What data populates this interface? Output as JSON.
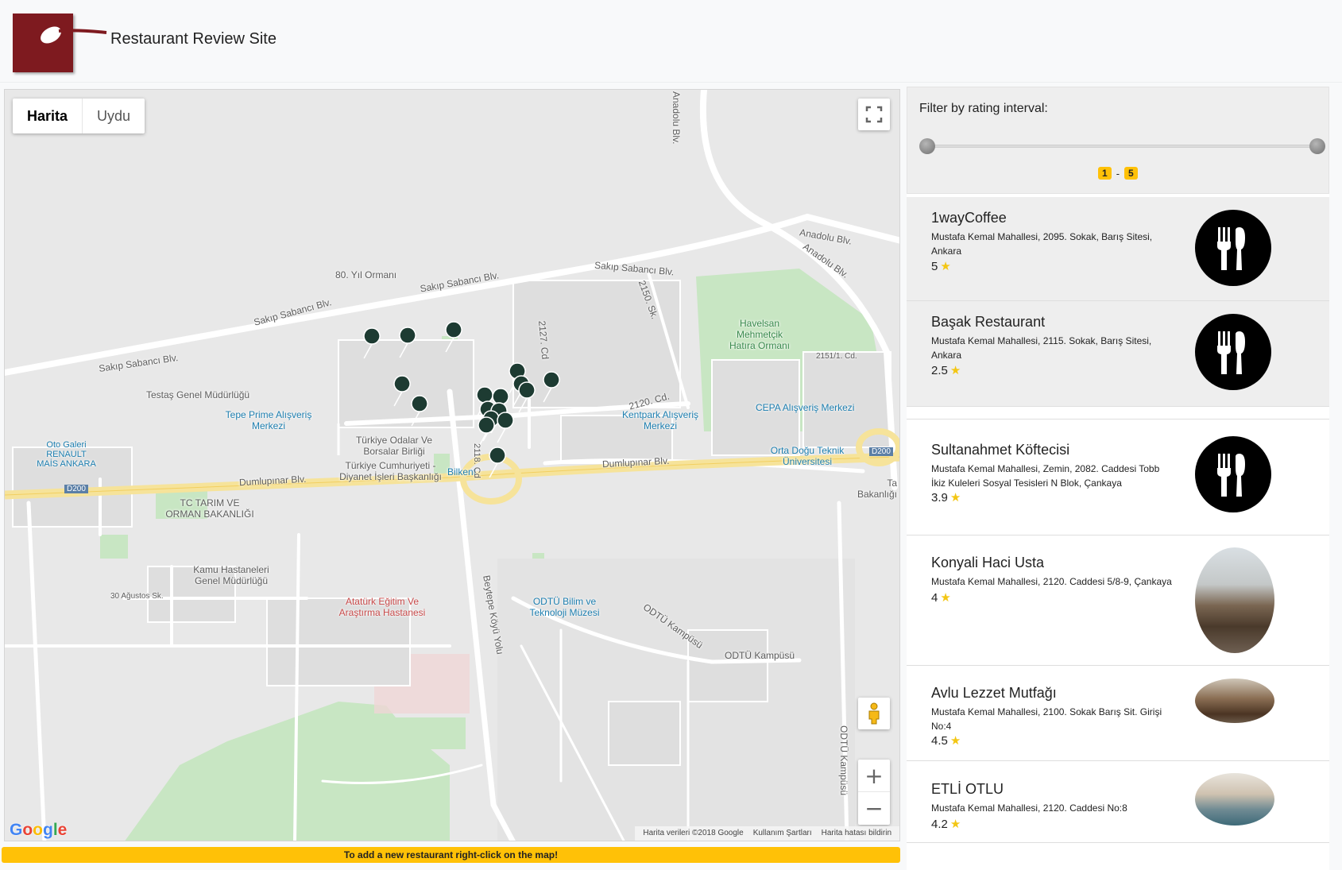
{
  "header": {
    "site_title": "Restaurant Review Site"
  },
  "map": {
    "maptype_options": [
      "Harita",
      "Uydu"
    ],
    "active_maptype": "Harita",
    "attribution": [
      "Harita verileri ©2018 Google",
      "Kullanım Şartları",
      "Harita hatası bildirin"
    ],
    "google_logo": "Google",
    "labels": {
      "sakip1": "Sakıp Sabancı Blv.",
      "sakip2": "Sakıp Sabancı Blv.",
      "sakip3": "Sakıp Sabancı Blv.",
      "sakip4": "Sakıp Sabancı Blv.",
      "anadolu1": "Anadolu Blv.",
      "anadolu2": "Anadolu Blv.",
      "anadolu3": "Anadolu Blv.",
      "dumlu1": "Dumlupınar Blv.",
      "dumlu2": "Dumlupınar Blv.",
      "yil80": "80. Yıl Ormanı",
      "havelsan": "Havelsan Mehmetçik Hatıra Ormanı",
      "testas": "Testaş Genel Müdürlüğü",
      "tepe": "Tepe Prime Alışveriş Merkezi",
      "otogaleri": "Oto Galeri RENAULT MAİS ANKARA",
      "odalar": "Türkiye Odalar Ve Borsalar Birliği",
      "diyanet": "Türkiye Cumhuriyeti - Diyanet İşleri Başkanlığı",
      "bilkent": "Bilkent",
      "kentpark": "Kentpark Alışveriş Merkezi",
      "cepa": "CEPA Alışveriş Merkezi",
      "odtu": "Orta Doğu Teknik Üniversitesi",
      "tarim": "TC TARIM VE ORMAN BAKANLIĞI",
      "kamu": "Kamu Hastaneleri Genel Müdürlüğü",
      "ataturk": "Atatürk Eğitim Ve Araştırma Hastanesi",
      "odtubilim": "ODTÜ Bilim ve Teknoloji Müzesi",
      "odtukamp1": "ODTÜ Kampüsü",
      "odtukamp2": "ODTÜ Kampüsü",
      "odtukamp3": "ODTÜ Kampüsü",
      "beytepe": "Beytepe Köyü Yolu",
      "bakanligi": "Ta Bakanlığı",
      "d200a": "D200",
      "d200b": "D200",
      "c2127": "2127. Cd",
      "c2120": "2120. Cd.",
      "c2150": "2150. Sk.",
      "c2118": "2118. Cd",
      "sk30": "30 Ağustos Sk.",
      "c2151": "2151/1. Cd."
    }
  },
  "map_notice": "To add a new restaurant right-click on the map!",
  "filter": {
    "label": "Filter by rating interval:",
    "min": 1,
    "max": 5,
    "min_label": "1",
    "max_label": "5",
    "separator": "-"
  },
  "restaurants": [
    {
      "name": "1wayCoffee",
      "address": "Mustafa Kemal Mahallesi, 2095. Sokak, Barış Sitesi, Ankara",
      "rating": "5",
      "image": "cutlery-icon"
    },
    {
      "name": "Başak Restaurant",
      "address": "Mustafa Kemal Mahallesi, 2115. Sokak, Barış Sitesi, Ankara",
      "rating": "2.5",
      "image": "cutlery-icon"
    },
    {
      "name": "Sultanahmet Köftecisi",
      "address": "Mustafa Kemal Mahallesi, Zemin, 2082. Caddesi Tobb İkiz Kuleleri Sosyal Tesisleri N Blok, Çankaya",
      "rating": "3.9",
      "image": "cutlery-icon"
    },
    {
      "name": "Konyali Haci Usta",
      "address": "Mustafa Kemal Mahallesi, 2120. Caddesi 5/8-9, Çankaya",
      "rating": "4",
      "image": "restaurant-photo"
    },
    {
      "name": "Avlu Lezzet Mutfağı",
      "address": "Mustafa Kemal Mahallesi, 2100. Sokak Barış Sit. Girişi No:4",
      "rating": "4.5",
      "image": "restaurant-photo"
    },
    {
      "name": "ETLİ OTLU",
      "address": "Mustafa Kemal Mahallesi, 2120. Caddesi No:8",
      "rating": "4.2",
      "image": "restaurant-photo"
    }
  ],
  "colors": {
    "accent": "#ffc107",
    "logo": "#7e1a1f",
    "star": "#f3c613",
    "marker": "#1d3b32"
  }
}
